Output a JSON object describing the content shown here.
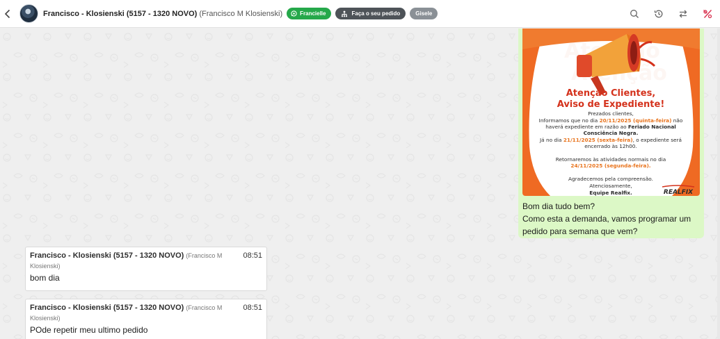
{
  "header": {
    "contact_name": "Francisco - Klosienski (5157 - 1320 NOVO)",
    "contact_sub": "(Francisco M Klosienski)",
    "badges": {
      "agent": "Francielle",
      "order": "Faça o seu pedido",
      "user": "Gisele"
    }
  },
  "colors": {
    "badge_green": "#25a84a",
    "badge_dark": "#4e5358",
    "badge_gray": "#8a9096",
    "outgoing_bubble": "#dcf8c6",
    "icon_red": "#d9314f"
  },
  "icons": {
    "back": "chevron-left-icon",
    "search": "search-icon",
    "history": "history-icon",
    "transfer": "transfer-icon",
    "close_ticket": "percent-close-icon"
  },
  "outgoing": {
    "poster": {
      "title_line1": "Atenção Clientes,",
      "title_line2": "Aviso de Expediente!",
      "bg_word": "Atenção",
      "greeting": "Prezados clientes,",
      "l1_a": "Informamos que no dia ",
      "l1_b": "20/11/2025 (quinta-feira)",
      "l1_c": " não",
      "l2_a": "haverá expediente em razão ao ",
      "l2_b": "Feriado Nacional",
      "l3": "Consciência Negra.",
      "l4_a": "Já no dia ",
      "l4_b": "21/11/2025 (sexta-feira)",
      "l4_c": ", o expediente será",
      "l5": "encerrado às 12h00.",
      "l6": "Retornaremos às atividades normais no dia",
      "l7": "24/11/2025 (segunda-feira).",
      "l8": "Agradecemos pela compreensão.",
      "l9": "Atenciosamente,",
      "l10": "Equipe Realfix.",
      "logo": "REALFIX"
    },
    "text_lines": [
      "Bom dia tudo bem?",
      "Como esta a demanda, vamos programar um",
      "pedido para semana que vem?"
    ]
  },
  "messages": [
    {
      "author": "Francisco - Klosienski (5157 - 1320 NOVO)",
      "author_sub": "(Francisco M Klosienski)",
      "time": "08:51",
      "text": "bom dia"
    },
    {
      "author": "Francisco - Klosienski (5157 - 1320 NOVO)",
      "author_sub": "(Francisco M Klosienski)",
      "time": "08:51",
      "text": "POde repetir meu ultimo pedido"
    }
  ]
}
